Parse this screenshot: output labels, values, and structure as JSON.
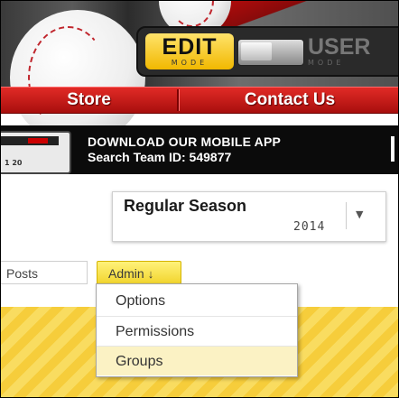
{
  "mode_toggle": {
    "edit_label": "EDIT",
    "edit_sub": "MODE",
    "user_label": "USER",
    "user_sub": "MODE"
  },
  "nav": {
    "items": [
      "Store",
      "Contact Us"
    ]
  },
  "banner": {
    "line1": "DOWNLOAD OUR MOBILE APP",
    "line2": "Search Team ID: 549877",
    "phone_numbers": "1  20"
  },
  "season": {
    "name": "Regular Season",
    "year": "2014"
  },
  "tabs": {
    "posts": "Posts",
    "admin": "Admin",
    "admin_arrow": "↓"
  },
  "admin_menu": {
    "items": [
      "Options",
      "Permissions",
      "Groups"
    ],
    "highlighted": "Groups"
  },
  "colors": {
    "nav_red": "#c81a18",
    "admin_yellow": "#f2d52f",
    "stripe_yellow": "#f6cd3b",
    "highlight": "#fbf2c4"
  }
}
